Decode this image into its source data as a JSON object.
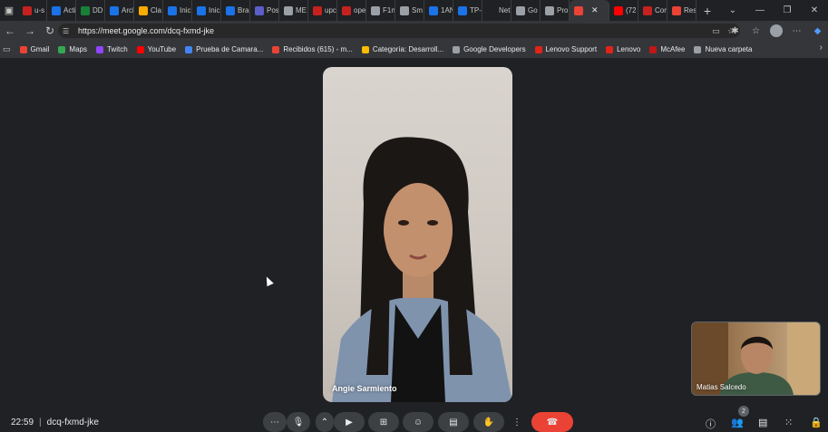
{
  "browser": {
    "tabs": [
      {
        "label": "u-s",
        "color": "#c5221f"
      },
      {
        "label": "Acti",
        "color": "#1a73e8"
      },
      {
        "label": "DD",
        "color": "#188038"
      },
      {
        "label": "Arcl",
        "color": "#1a73e8"
      },
      {
        "label": "Cla",
        "color": "#f9ab00"
      },
      {
        "label": "Inic",
        "color": "#1a73e8"
      },
      {
        "label": "Inic",
        "color": "#1a73e8"
      },
      {
        "label": "Brai",
        "color": "#1a73e8"
      },
      {
        "label": "Pos",
        "color": "#5b5fc7"
      },
      {
        "label": "ME",
        "color": "#9aa0a6"
      },
      {
        "label": "upc",
        "color": "#c5221f"
      },
      {
        "label": "ope",
        "color": "#c5221f"
      },
      {
        "label": "F1n",
        "color": "#9aa0a6"
      },
      {
        "label": "Sm",
        "color": "#9aa0a6"
      },
      {
        "label": "1AN",
        "color": "#1a73e8"
      },
      {
        "label": "TP-",
        "color": "#1a73e8"
      },
      {
        "label": "Net",
        "color": "#202124"
      },
      {
        "label": "Go",
        "color": "#9aa0a6"
      },
      {
        "label": "Pro",
        "color": "#9aa0a6"
      },
      {
        "label": "",
        "color": "#ea4335",
        "active": true
      },
      {
        "label": "(72",
        "color": "#ff0000"
      },
      {
        "label": "Cor",
        "color": "#c5221f"
      },
      {
        "label": "Res",
        "color": "#ea4335"
      }
    ],
    "close_tab_glyph": "✕",
    "new_tab_glyph": "+",
    "url": "https://meet.google.com/dcq-fxmd-jke",
    "bookmarks": [
      {
        "label": "Gmail",
        "color": "#ea4335"
      },
      {
        "label": "Maps",
        "color": "#34a853"
      },
      {
        "label": "Twitch",
        "color": "#9146ff"
      },
      {
        "label": "YouTube",
        "color": "#ff0000"
      },
      {
        "label": "Prueba de Camara...",
        "color": "#4285f4"
      },
      {
        "label": "Recibidos (615) - m...",
        "color": "#ea4335"
      },
      {
        "label": "Categoría: Desarroll...",
        "color": "#fbbc04"
      },
      {
        "label": "Google Developers",
        "color": "#9aa0a6"
      },
      {
        "label": "Lenovo Support",
        "color": "#e2231a"
      },
      {
        "label": "Lenovo",
        "color": "#e2231a"
      },
      {
        "label": "McAfee",
        "color": "#c01818"
      },
      {
        "label": "Nueva carpeta",
        "color": "#9aa0a6"
      }
    ]
  },
  "meeting": {
    "main_participant": "Angie Sarmiento",
    "self_participant": "Matias Salcedo",
    "time": "22:59",
    "meeting_code": "dcq-fxmd-jke",
    "participant_count": "2"
  }
}
